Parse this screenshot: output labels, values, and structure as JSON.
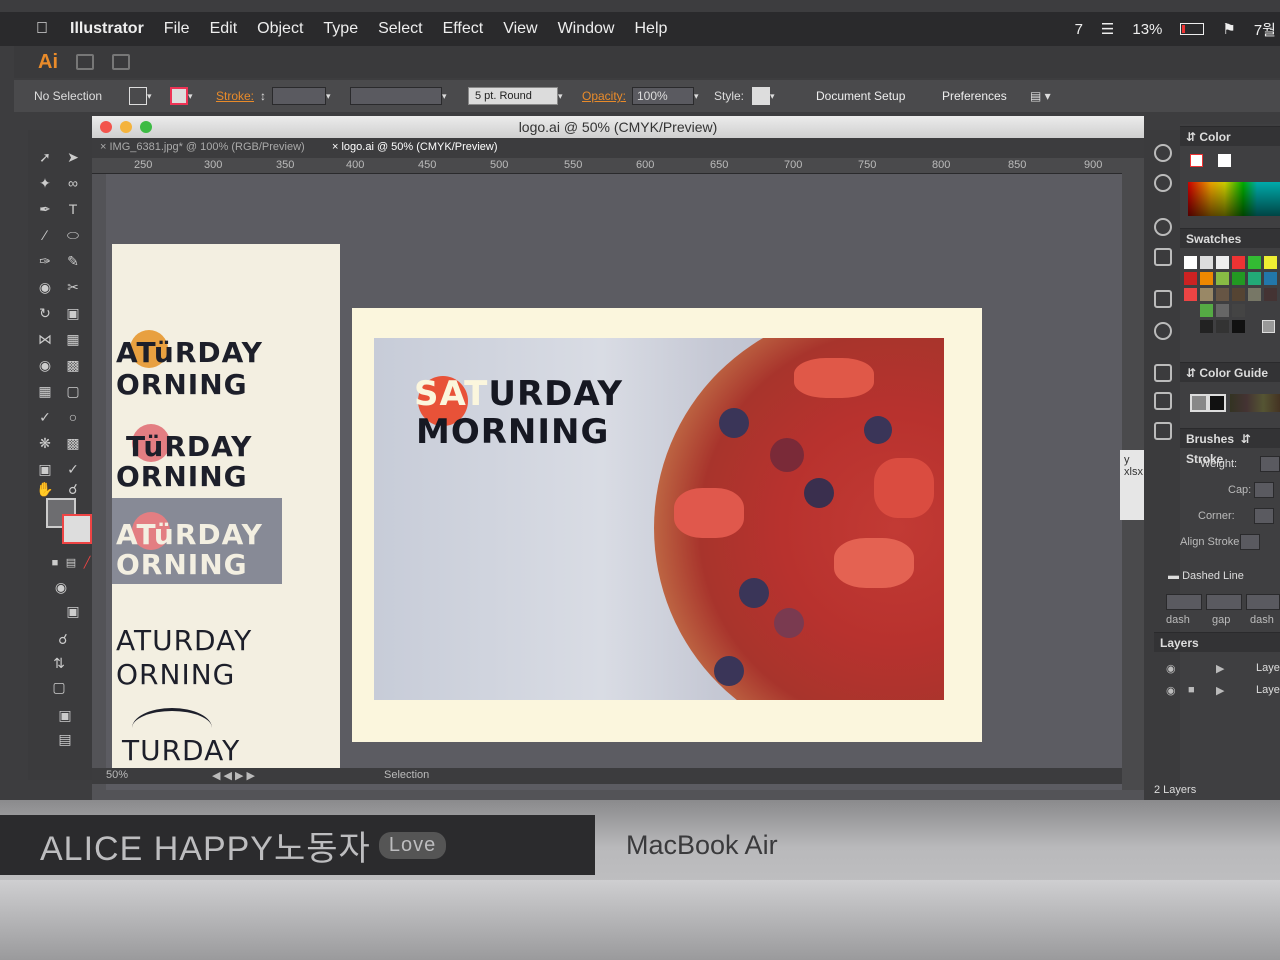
{
  "menubar": {
    "app_name": "Illustrator",
    "items": [
      "File",
      "Edit",
      "Object",
      "Type",
      "Select",
      "Effect",
      "View",
      "Window",
      "Help"
    ],
    "status_number": "7",
    "battery": "13%",
    "date": "7월"
  },
  "appbar": {
    "logo": "Ai"
  },
  "controlbar": {
    "selection": "No Selection",
    "stroke_label": "Stroke:",
    "brush_value": "5 pt. Round",
    "opacity_label": "Opacity:",
    "opacity_value": "100%",
    "style_label": "Style:",
    "document_setup": "Document Setup",
    "preferences": "Preferences"
  },
  "document": {
    "title": "logo.ai @ 50% (CMYK/Preview)",
    "tabs": [
      "IMG_6381.jpg* @ 100% (RGB/Preview)",
      "logo.ai @ 50% (CMYK/Preview)"
    ],
    "ruler": [
      "250",
      "300",
      "350",
      "400",
      "450",
      "500",
      "550",
      "600",
      "650",
      "700",
      "750",
      "800",
      "850",
      "900"
    ],
    "status": {
      "zoom": "50%",
      "tool": "Selection"
    }
  },
  "artwork": {
    "logo_line1_a": "SAT",
    "logo_line1_b": "URDAY",
    "logo_line2": "MORNING",
    "left_variants": [
      {
        "line1": "ATüRDAY",
        "line2": "ORNING"
      },
      {
        "line1": "TüRDAY",
        "line2": "ORNING"
      },
      {
        "line1": "ATüRDAY",
        "line2": "ORNING"
      },
      {
        "line1": "ATURDAY",
        "line2": "ORNING"
      },
      {
        "line1": "TURDAY",
        "line2": ""
      }
    ]
  },
  "panels": {
    "color": "Color",
    "swatches": "Swatches",
    "color_guide": "Color Guide",
    "brushes": "Brushes",
    "stroke": "Stroke",
    "weight": "Weight:",
    "cap": "Cap:",
    "corner": "Corner:",
    "align_stroke": "Align Stroke:",
    "dashed_line": "Dashed Line",
    "dash": "dash",
    "gap": "gap",
    "dash2": "dash",
    "layers": "Layers",
    "layer_items": [
      "Laye",
      "Laye"
    ],
    "layers_count": "2 Layers"
  },
  "popup": {
    "line1": "y",
    "line2": "xlsx"
  },
  "hardware": {
    "sticker": "ALICE HAPPY노동자",
    "sticker_badge": "Love",
    "model": "MacBook Air"
  },
  "colors": {
    "accent_orange": "#e98b2a",
    "logo_red": "#e85238",
    "logo_navy": "#161822",
    "artboard_cream": "#fbf6dd"
  }
}
